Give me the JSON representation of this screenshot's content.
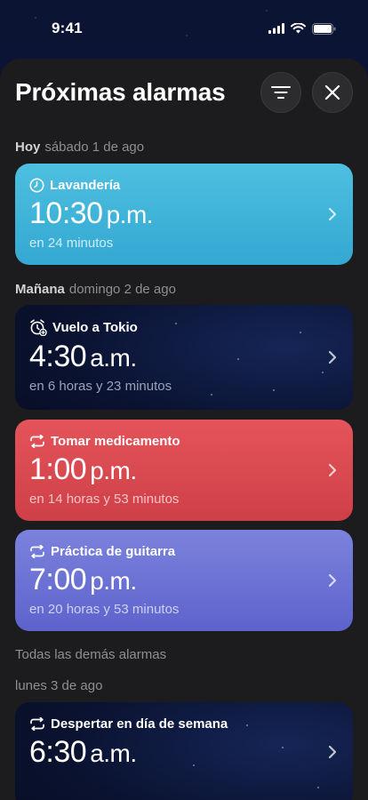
{
  "status": {
    "time": "9:41"
  },
  "header": {
    "title": "Próximas alarmas"
  },
  "sections": {
    "today": {
      "label": "Hoy",
      "date": "sábado 1 de ago"
    },
    "tomorrow": {
      "label": "Mañana",
      "date": "domingo 2 de ago"
    },
    "others": {
      "label": "Todas las demás alarmas"
    },
    "monday": {
      "label": "lunes 3 de ago"
    }
  },
  "alarms": [
    {
      "name": "Lavandería",
      "time": "10:30",
      "ampm": "p.m.",
      "relative": "en 24 minutos",
      "icon": "clock-icon",
      "color": "#45b8dc"
    },
    {
      "name": "Vuelo a Tokio",
      "time": "4:30",
      "ampm": "a.m.",
      "relative": "en 6 horas y 23 minutos",
      "icon": "alarm-clock-add-icon",
      "color": "#0a1230"
    },
    {
      "name": "Tomar medicamento",
      "time": "1:00",
      "ampm": "p.m.",
      "relative": "en 14 horas y 53 minutos",
      "icon": "repeat-icon",
      "color": "#dc4a51"
    },
    {
      "name": "Práctica de guitarra",
      "time": "7:00",
      "ampm": "p.m.",
      "relative": "en 20 horas y 53 minutos",
      "icon": "repeat-icon",
      "color": "#6c72d4"
    },
    {
      "name": "Despertar en día de semana",
      "time": "6:30",
      "ampm": "a.m.",
      "relative": "",
      "icon": "repeat-icon",
      "color": "#0a1230"
    }
  ]
}
